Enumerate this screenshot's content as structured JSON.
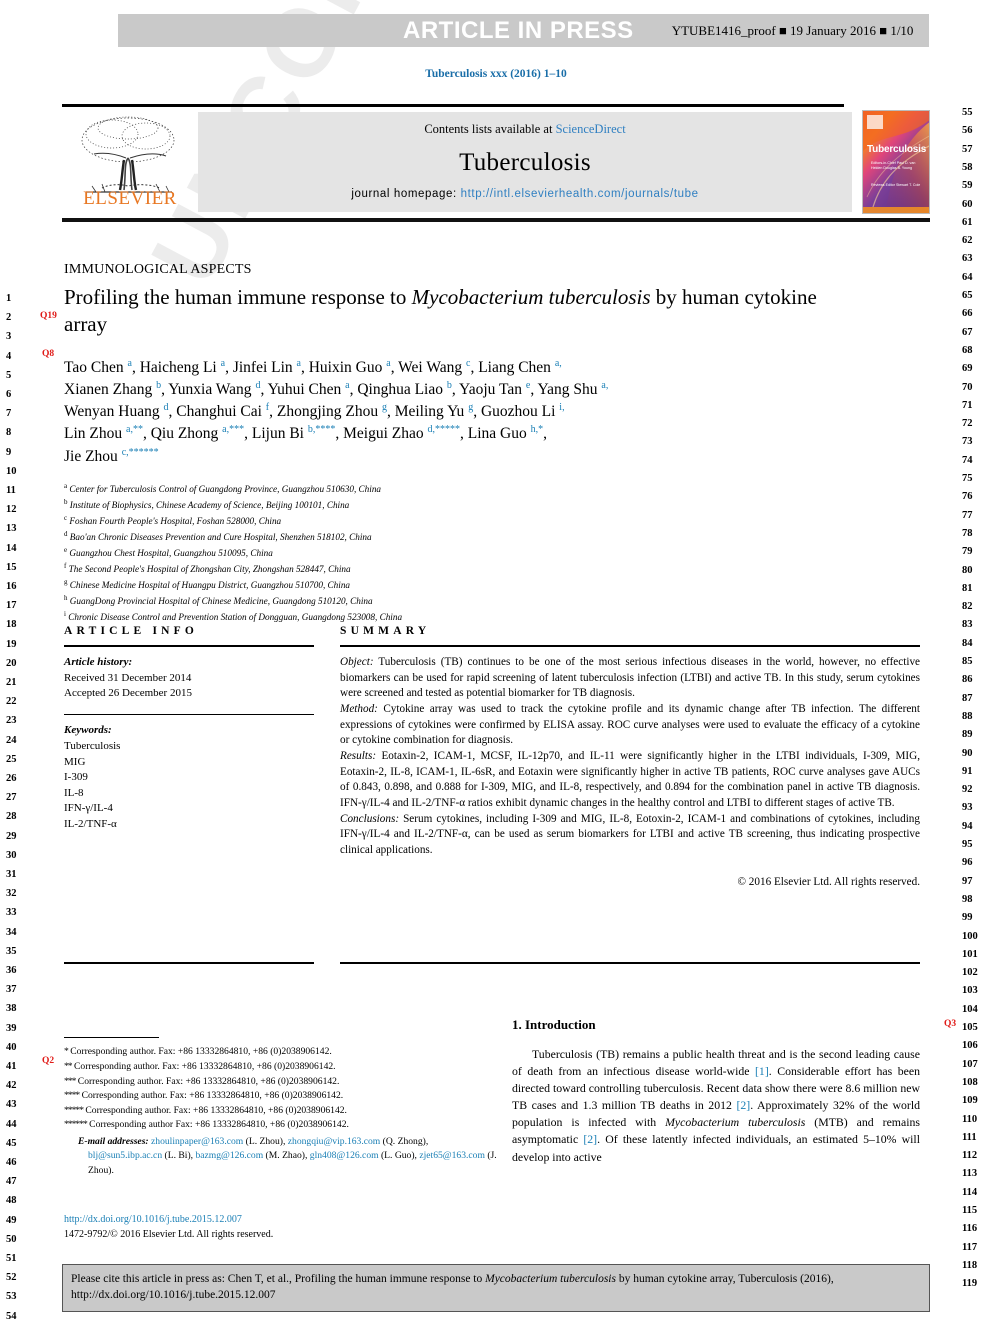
{
  "header": {
    "press_label": "ARTICLE IN PRESS",
    "proof_meta": "YTUBE1416_proof ■ 19 January 2016 ■ 1/10",
    "journal_line": "Tuberculosis xxx (2016) 1–10"
  },
  "masthead": {
    "contents_prefix": "Contents lists available at ",
    "contents_link": "ScienceDirect",
    "journal_name": "Tuberculosis",
    "homepage_prefix": "journal homepage: ",
    "homepage_url": "http://intl.elsevierhealth.com/journals/tube",
    "publisher": "ELSEVIER",
    "cover_title": "Tuberculosis",
    "cover_sub": "Editors-in-Chief Paul D. van Helden Douglas B. Young",
    "cover_sub2": "Reviews Editor Stewart T. Cole"
  },
  "article": {
    "section_head": "IMMUNOLOGICAL ASPECTS",
    "title_part1": "Profiling the human immune response to ",
    "title_italic": "Mycobacterium tuberculosis",
    "title_part2": " by human cytokine array",
    "authors_line1": "Tao Chen a, Haicheng Li a, Jinfei Lin a, Huixin Guo a, Wei Wang c, Liang Chen a,",
    "authors_line2": "Xianen Zhang b, Yunxia Wang d, Yuhui Chen a, Qinghua Liao b, Yaoju Tan e, Yang Shu a,",
    "authors_line3": "Wenyan Huang d, Changhui Cai f, Zhongjing Zhou g, Meiling Yu g, Guozhou Li i,",
    "authors_line4": "Lin Zhou a,**, Qiu Zhong a,***, Lijun Bi b,****, Meigui Zhao d,*****, Lina Guo h,*,",
    "authors_line5": "Jie Zhou c,******",
    "affiliations": [
      {
        "mark": "a",
        "text": "Center for Tuberculosis Control of Guangdong Province, Guangzhou 510630, China"
      },
      {
        "mark": "b",
        "text": "Institute of Biophysics, Chinese Academy of Science, Beijing 100101, China"
      },
      {
        "mark": "c",
        "text": "Foshan Fourth People's Hospital, Foshan 528000, China"
      },
      {
        "mark": "d",
        "text": "Bao'an Chronic Diseases Prevention and Cure Hospital, Shenzhen 518102, China"
      },
      {
        "mark": "e",
        "text": "Guangzhou Chest Hospital, Guangzhou 510095, China"
      },
      {
        "mark": "f",
        "text": "The Second People's Hospital of Zhongshan City, Zhongshan 528447, China"
      },
      {
        "mark": "g",
        "text": "Chinese Medicine Hospital of Huangpu District, Guangzhou 510700, China"
      },
      {
        "mark": "h",
        "text": "GuangDong Provincial Hospital of Chinese Medicine, Guangdong 510120, China"
      },
      {
        "mark": "i",
        "text": "Chronic Disease Control and Prevention Station of Dongguan, Guangdong 523008, China"
      }
    ]
  },
  "article_info": {
    "heading": "ARTICLE INFO",
    "history_label": "Article history:",
    "received": "Received 31 December 2014",
    "accepted": "Accepted 26 December 2015",
    "keywords_label": "Keywords:",
    "keywords": [
      "Tuberculosis",
      "MIG",
      "I-309",
      "IL-8",
      "IFN-γ/IL-4",
      "IL-2/TNF-α"
    ]
  },
  "summary": {
    "heading": "SUMMARY",
    "object_label": "Object:",
    "object_text": " Tuberculosis (TB) continues to be one of the most serious infectious diseases in the world, however, no effective biomarkers can be used for rapid screening of latent tuberculosis infection (LTBI) and active TB. In this study, serum cytokines were screened and tested as potential biomarker for TB diagnosis.",
    "method_label": "Method:",
    "method_text": " Cytokine array was used to track the cytokine profile and its dynamic change after TB infection. The different expressions of cytokines were confirmed by ELISA assay. ROC curve analyses were used to evaluate the efficacy of a cytokine or cytokine combination for diagnosis.",
    "results_label": "Results:",
    "results_text": " Eotaxin-2, ICAM-1, MCSF, IL-12p70, and IL-11 were significantly higher in the LTBI individuals, I-309, MIG, Eotaxin-2, IL-8, ICAM-1, IL-6sR, and Eotaxin were significantly higher in active TB patients, ROC curve analyses gave AUCs of 0.843, 0.898, and 0.888 for I-309, MIG, and IL-8, respectively, and 0.894 for the combination panel in active TB diagnosis. IFN-γ/IL-4 and IL-2/TNF-α ratios exhibit dynamic changes in the healthy control and LTBI to different stages of active TB.",
    "conclusions_label": "Conclusions:",
    "conclusions_text": " Serum cytokines, including I-309 and MIG, IL-8, Eotoxin-2, ICAM-1 and combinations of cytokines, including IFN-γ/IL-4 and IL-2/TNF-α, can be used as serum biomarkers for LTBI and active TB screening, thus indicating prospective clinical applications.",
    "copyright": "© 2016 Elsevier Ltd. All rights reserved."
  },
  "footnotes": {
    "lines": [
      "* Corresponding author. Fax: +86 13332864810, +86 (0)2038906142.",
      "** Corresponding author. Fax: +86 13332864810, +86 (0)2038906142.",
      "*** Corresponding author. Fax: +86 13332864810, +86 (0)2038906142.",
      "**** Corresponding author. Fax: +86 13332864810, +86 (0)2038906142.",
      "***** Corresponding author. Fax: +86 13332864810, +86 (0)2038906142.",
      "****** Corresponding author Fax: +86 13332864810, +86 (0)2038906142."
    ],
    "email_label": "E-mail addresses:",
    "emails": [
      {
        "addr": "zhoulinpaper@163.com",
        "who": " (L. Zhou), "
      },
      {
        "addr": "zhongqiu@vip.163.com",
        "who": " (Q. Zhong), "
      },
      {
        "addr": "blj@sun5.ibp.ac.cn",
        "who": " (L. Bi), "
      },
      {
        "addr": "bazmg@126.com",
        "who": " (M. Zhao), "
      },
      {
        "addr": "gln408@126.com",
        "who": " (L. Guo), "
      },
      {
        "addr": "zjet65@163.com",
        "who": " (J. Zhou)."
      }
    ],
    "doi": "http://dx.doi.org/10.1016/j.tube.2015.12.007",
    "issn_line": "1472-9792/© 2016 Elsevier Ltd. All rights reserved."
  },
  "introduction": {
    "heading": "1. Introduction",
    "paragraph_parts": [
      {
        "t": "Tuberculosis (TB) remains a public health threat and is the second leading cause of death from an infectious disease world-wide ",
        "k": "plain"
      },
      {
        "t": "[1]",
        "k": "ref"
      },
      {
        "t": ". Considerable effort has been directed toward controlling tuberculosis. Recent data show there were 8.6 million new TB cases and 1.3 million TB deaths in 2012 ",
        "k": "plain"
      },
      {
        "t": "[2]",
        "k": "ref"
      },
      {
        "t": ". Approximately 32% of the world population is infected with ",
        "k": "plain"
      },
      {
        "t": "Mycobacterium tuberculosis",
        "k": "italic"
      },
      {
        "t": " (MTB) and remains asymptomatic ",
        "k": "plain"
      },
      {
        "t": "[2]",
        "k": "ref"
      },
      {
        "t": ". Of these latently infected individuals, an estimated 5–10% will develop into active",
        "k": "plain"
      }
    ]
  },
  "cite_box": {
    "part1": "Please cite this article in press as: Chen T, et al., Profiling the human immune response to ",
    "italic": "Mycobacterium tuberculosis",
    "part2": " by human cytokine array, Tuberculosis (2016), http://dx.doi.org/10.1016/j.tube.2015.12.007"
  },
  "watermark": {
    "text": "UNCORRECTED PROOF"
  },
  "margins": {
    "left_numbers_start": 1,
    "left_numbers_end": 54,
    "right_numbers_start": 55,
    "right_numbers_end": 119,
    "query_markers": [
      {
        "label": "Q19",
        "side": "left",
        "line": 3
      },
      {
        "label": "Q8",
        "side": "left",
        "line": 5
      },
      {
        "label": "Q2",
        "side": "left",
        "line": 45
      },
      {
        "label": "Q3",
        "side": "right",
        "line": 107
      }
    ]
  },
  "colors": {
    "link": "#1a7fb5",
    "bar_gray": "#c9c9c9",
    "masthead_gray": "#e4e4e4",
    "elsevier_orange": "#E87722",
    "query_red": "#e01b18"
  }
}
